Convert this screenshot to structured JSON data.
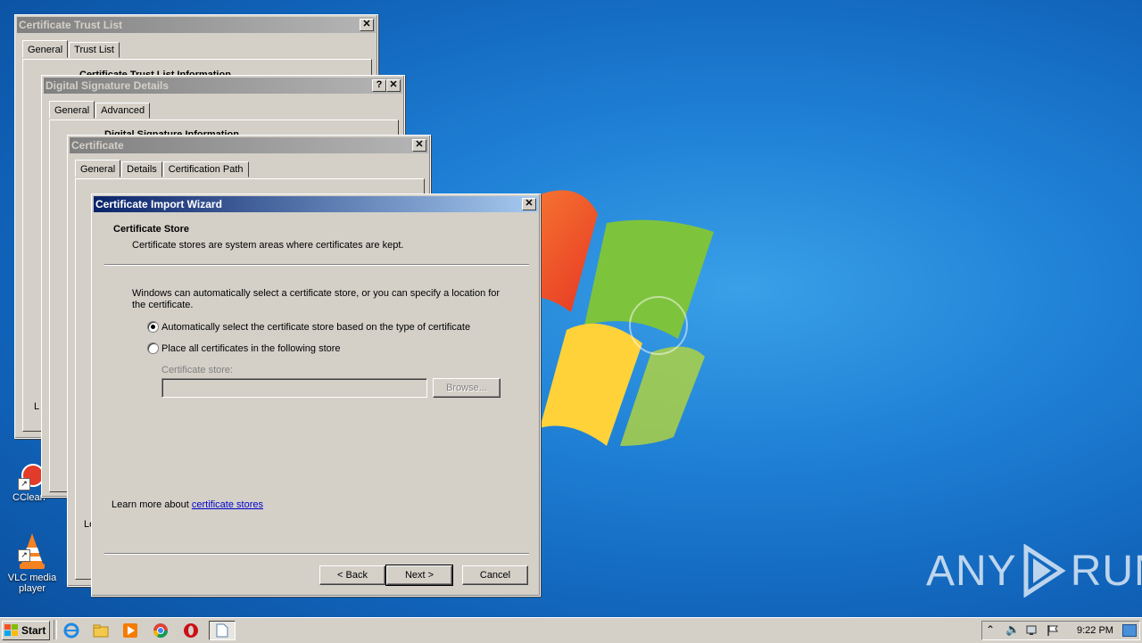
{
  "desktop": {
    "icons": [
      {
        "label": "CClean"
      },
      {
        "label": "VLC media player"
      }
    ],
    "watermark": {
      "left": "ANY",
      "right": "RUN"
    }
  },
  "ctl_window": {
    "title": "Certificate Trust List",
    "close": "✕",
    "tabs": [
      "General",
      "Trust List"
    ],
    "partial_heading": "Certificate Trust List Information"
  },
  "dsd_window": {
    "title": "Digital Signature Details",
    "help": "?",
    "close": "✕",
    "tabs": [
      "General",
      "Advanced"
    ],
    "partial_heading": "Digital Signature Information",
    "partial_left": "L"
  },
  "cert_window": {
    "title": "Certificate",
    "close": "✕",
    "tabs": [
      "General",
      "Details",
      "Certification Path"
    ],
    "partial_left": "Le"
  },
  "wizard": {
    "title": "Certificate Import Wizard",
    "close": "✕",
    "heading": "Certificate Store",
    "subheading": "Certificate stores are system areas where certificates are kept.",
    "intro_line1": "Windows can automatically select a certificate store, or you can specify a location for",
    "intro_line2": "the certificate.",
    "options": [
      {
        "label": "Automatically select the certificate store based on the type of certificate",
        "selected": true
      },
      {
        "label": "Place all certificates in the following store",
        "selected": false
      }
    ],
    "store_label": "Certificate store:",
    "store_value": "",
    "browse": "Browse...",
    "learn_prefix": "Learn more about ",
    "learn_link": "certificate stores",
    "back": "< Back",
    "next": "Next >",
    "cancel": "Cancel"
  },
  "taskbar": {
    "start": "Start",
    "time": "9:22 PM"
  }
}
